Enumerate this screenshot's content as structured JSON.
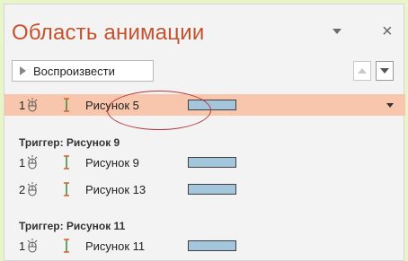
{
  "pane": {
    "title": "Область анимации",
    "close_glyph": "×",
    "play_label": "Воспроизвести"
  },
  "selected_row": {
    "number": "1",
    "name": "Рисунок 5"
  },
  "groups": [
    {
      "trigger_label": "Триггер: Рисунок 9",
      "items": [
        {
          "number": "1",
          "name": "Рисунок 9"
        },
        {
          "number": "2",
          "name": "Рисунок 13"
        }
      ]
    },
    {
      "trigger_label": "Триггер: Рисунок 11",
      "items": [
        {
          "number": "1",
          "name": "Рисунок 11"
        }
      ]
    }
  ],
  "colors": {
    "title": "#c4522c",
    "selected_row_bg": "#f8c6ad",
    "timeline_bar": "#a4c6dc",
    "annotation_circle": "#b23a3a",
    "page_bg": "#e7f5c8"
  },
  "icons": [
    "mouse-click-icon",
    "entrance-effect-icon",
    "chevron-down-icon",
    "close-icon",
    "play-icon",
    "move-up-icon",
    "move-down-icon"
  ]
}
